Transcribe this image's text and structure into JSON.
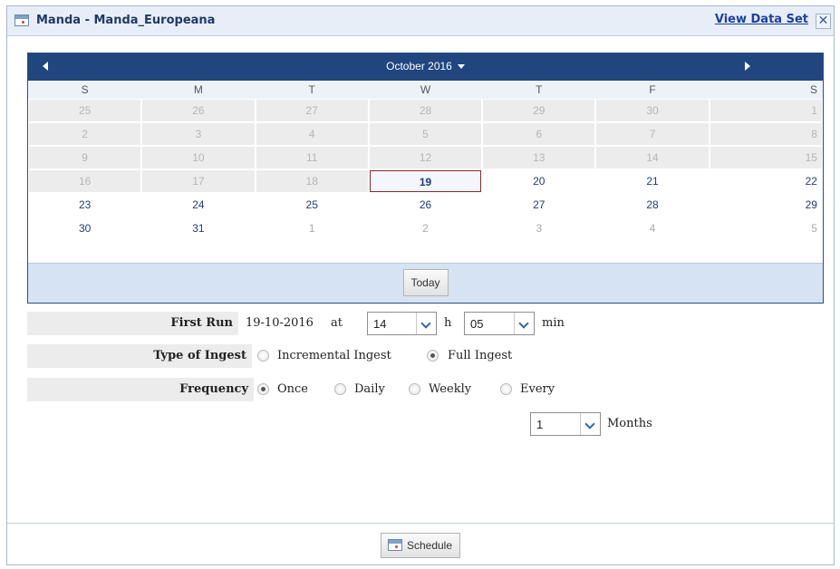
{
  "dialog": {
    "title": "Manda - Manda_Europeana",
    "view_link": "View Data Set",
    "close_glyph": "✕"
  },
  "calendar": {
    "month_title": "October 2016",
    "weekdays": [
      "S",
      "M",
      "T",
      "W",
      "T",
      "F",
      "S"
    ],
    "weeks": [
      [
        "25",
        "26",
        "27",
        "28",
        "29",
        "30",
        "1"
      ],
      [
        "2",
        "3",
        "4",
        "5",
        "6",
        "7",
        "8"
      ],
      [
        "9",
        "10",
        "11",
        "12",
        "13",
        "14",
        "15"
      ],
      [
        "16",
        "17",
        "18",
        "19",
        "20",
        "21",
        "22"
      ],
      [
        "23",
        "24",
        "25",
        "26",
        "27",
        "28",
        "29"
      ],
      [
        "30",
        "31",
        "1",
        "2",
        "3",
        "4",
        "5"
      ]
    ],
    "selected_day": "19",
    "today_label": "Today"
  },
  "form": {
    "first_run": {
      "label": "First Run",
      "date": "19-10-2016",
      "at": "at",
      "hour": "14",
      "hour_unit": "h",
      "minute": "05",
      "minute_unit": "min"
    },
    "type_of_ingest": {
      "label": "Type of Ingest",
      "options": [
        "Incremental Ingest",
        "Full Ingest"
      ],
      "selected": "Full Ingest"
    },
    "frequency": {
      "label": "Frequency",
      "options": [
        "Once",
        "Daily",
        "Weekly",
        "Every"
      ],
      "selected": "Once",
      "every_value": "1",
      "every_unit": "Months"
    }
  },
  "footer": {
    "schedule_label": "Schedule"
  },
  "colors": {
    "calendar_header": "#21457f",
    "calendar_footer": "#d6e3f3",
    "link": "#1a3fa8",
    "selected_border": "#8b2b2b"
  }
}
